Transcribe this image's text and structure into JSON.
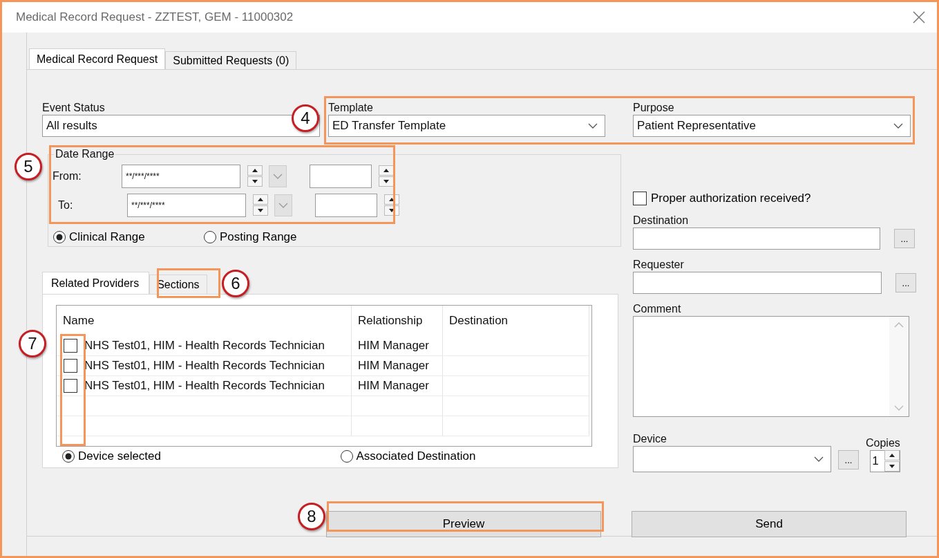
{
  "window": {
    "title": "Medical Record Request - ZZTEST, GEM - 11000302"
  },
  "tabs": [
    {
      "label": "Medical Record Request",
      "selected": true
    },
    {
      "label": "Submitted Requests (0)",
      "selected": false
    }
  ],
  "event_status": {
    "label": "Event Status",
    "value": "All results"
  },
  "template": {
    "label": "Template",
    "value": "ED Transfer Template"
  },
  "purpose": {
    "label": "Purpose",
    "value": "Patient Representative"
  },
  "date_range": {
    "title": "Date Range",
    "rows": [
      {
        "label": "From:",
        "value": "**/***/****"
      },
      {
        "label": "To:",
        "value": "**/***/****"
      }
    ],
    "options": [
      {
        "label": "Clinical Range",
        "selected": true
      },
      {
        "label": "Posting Range",
        "selected": false
      }
    ]
  },
  "inner_tabs": [
    {
      "label": "Related Providers",
      "selected": true
    },
    {
      "label": "Sections",
      "selected": false
    }
  ],
  "providers": {
    "columns": [
      "Name",
      "Relationship",
      "Destination"
    ],
    "rows": [
      {
        "checked": false,
        "name": "NHS Test01, HIM - Health Records Technician",
        "relationship": "HIM Manager"
      },
      {
        "checked": false,
        "name": "NHS Test01, HIM - Health Records Technician",
        "relationship": "HIM Manager"
      },
      {
        "checked": false,
        "name": "NHS Test01, HIM - Health Records Technician",
        "relationship": "HIM Manager"
      }
    ],
    "options": [
      {
        "label": "Device selected",
        "selected": true
      },
      {
        "label": "Associated Destination",
        "selected": false
      }
    ]
  },
  "authorization": {
    "label": "Proper authorization received?",
    "checked": false
  },
  "destination": {
    "label": "Destination",
    "button": "..."
  },
  "requester": {
    "label": "Requester",
    "button": "..."
  },
  "comment": {
    "label": "Comment"
  },
  "device": {
    "label": "Device",
    "button": "..."
  },
  "copies": {
    "label": "Copies",
    "value": "1"
  },
  "buttons": [
    "Preview",
    "Send"
  ],
  "callouts": [
    {
      "number": "4"
    },
    {
      "number": "5"
    },
    {
      "number": "6"
    },
    {
      "number": "7"
    },
    {
      "number": "8"
    }
  ]
}
